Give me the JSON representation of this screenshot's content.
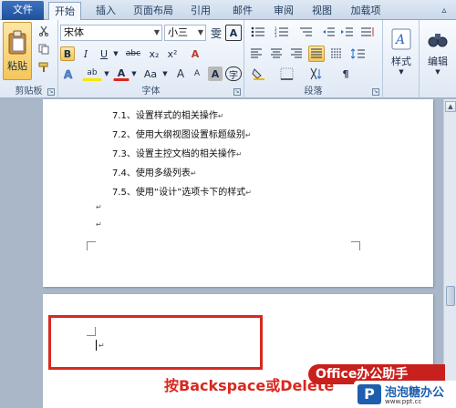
{
  "tabs": {
    "file": "文件",
    "home": "开始",
    "insert": "插入",
    "page_layout": "页面布局",
    "references": "引用",
    "mailings": "邮件",
    "review": "审阅",
    "view": "视图",
    "addins": "加载项"
  },
  "ribbon": {
    "clipboard": {
      "paste_label": "粘贴",
      "group_label": "剪贴板"
    },
    "font": {
      "font_name": "宋体",
      "font_size": "小三",
      "phonetic_glyph": "雯",
      "border_glyph": "A",
      "bold": "B",
      "italic": "I",
      "underline": "U",
      "strike": "abc",
      "subscript": "x₂",
      "superscript": "x²",
      "clear_format": "A",
      "highlight": "ab",
      "font_color": "A",
      "change_case": "Aa",
      "grow": "A",
      "shrink": "A",
      "shading": "A",
      "enclose": "字",
      "group_label": "字体"
    },
    "paragraph": {
      "group_label": "段落"
    },
    "styles": {
      "label": "样式"
    },
    "editing": {
      "label": "编辑"
    }
  },
  "document": {
    "toc_lines": [
      "7.1、设置样式的相关操作",
      "7.2、使用大纲视图设置标题级别",
      "7.3、设置主控文档的相关操作",
      "7.4、使用多级列表",
      "7.5、使用“设计”选项卡下的样式"
    ],
    "para_mark": "↵"
  },
  "overlay": {
    "caption": "按Backspace或Delete",
    "badge": "Office办公助手",
    "logo_name": "泡泡糖办公",
    "logo_url": "www.ppt.cc"
  },
  "colors": {
    "accent_red": "#d8281f",
    "file_tab": "#2b5fad",
    "highlight_yellow": "#f6c65a",
    "page_bg": "#a9b7c9"
  }
}
